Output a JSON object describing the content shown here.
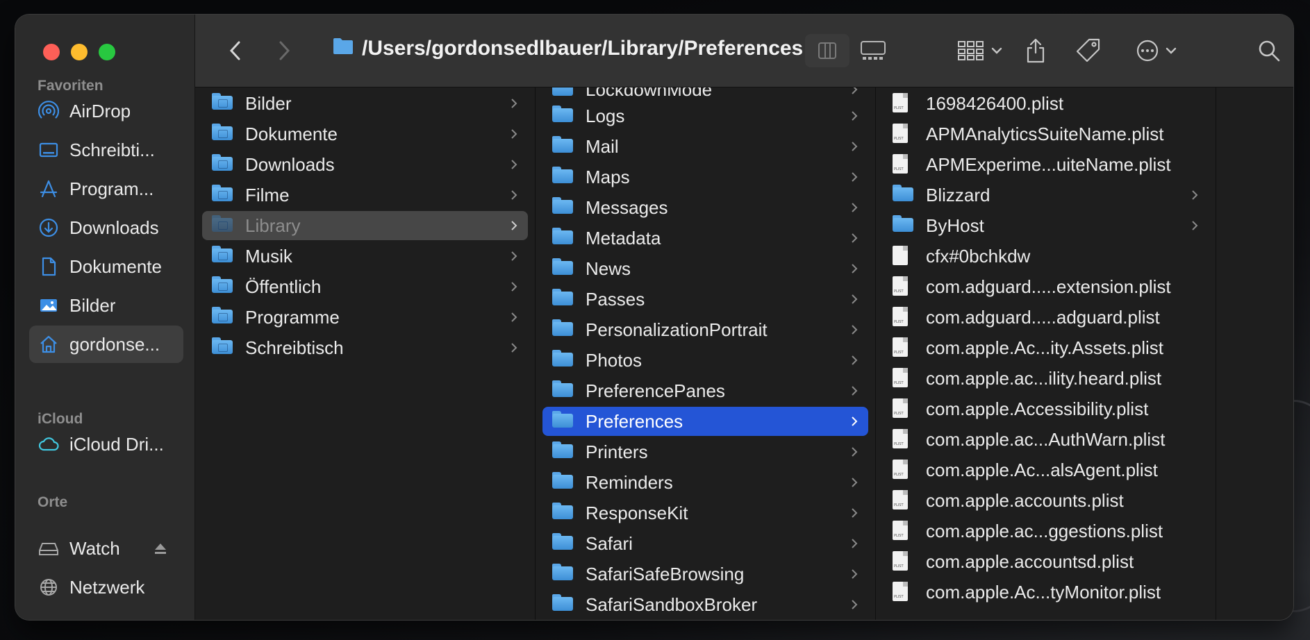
{
  "window": {
    "path": "/Users/gordonsedlbauer/Library/Preferences"
  },
  "sidebar": {
    "sections": [
      {
        "title": "Favoriten",
        "items": [
          {
            "label": "AirDrop",
            "icon": "airdrop-icon"
          },
          {
            "label": "Schreibti...",
            "icon": "desktop-icon"
          },
          {
            "label": "Program...",
            "icon": "applications-icon"
          },
          {
            "label": "Downloads",
            "icon": "downloads-icon"
          },
          {
            "label": "Dokumente",
            "icon": "document-icon"
          },
          {
            "label": "Bilder",
            "icon": "photo-icon"
          },
          {
            "label": "gordonse...",
            "icon": "home-icon",
            "active": true
          }
        ]
      },
      {
        "title": "iCloud",
        "items": [
          {
            "label": "iCloud Dri...",
            "icon": "icloud-icon"
          }
        ]
      },
      {
        "title": "Orte",
        "items": [
          {
            "label": "Watch",
            "icon": "drive-icon"
          },
          {
            "label": "Netzwerk",
            "icon": "network-icon"
          }
        ]
      }
    ]
  },
  "columns": [
    {
      "items": [
        {
          "label": "Bilder",
          "kind": "folder"
        },
        {
          "label": "Dokumente",
          "kind": "folder"
        },
        {
          "label": "Downloads",
          "kind": "folder"
        },
        {
          "label": "Filme",
          "kind": "folder"
        },
        {
          "label": "Library",
          "kind": "folder",
          "state": "selected-inactive"
        },
        {
          "label": "Musik",
          "kind": "folder"
        },
        {
          "label": "Öffentlich",
          "kind": "folder"
        },
        {
          "label": "Programme",
          "kind": "folder"
        },
        {
          "label": "Schreibtisch",
          "kind": "folder"
        }
      ]
    },
    {
      "items": [
        {
          "label": "LockdownMode",
          "kind": "folder"
        },
        {
          "label": "Logs",
          "kind": "folder"
        },
        {
          "label": "Mail",
          "kind": "folder"
        },
        {
          "label": "Maps",
          "kind": "folder"
        },
        {
          "label": "Messages",
          "kind": "folder"
        },
        {
          "label": "Metadata",
          "kind": "folder"
        },
        {
          "label": "News",
          "kind": "folder"
        },
        {
          "label": "Passes",
          "kind": "folder"
        },
        {
          "label": "PersonalizationPortrait",
          "kind": "folder"
        },
        {
          "label": "Photos",
          "kind": "folder"
        },
        {
          "label": "PreferencePanes",
          "kind": "folder"
        },
        {
          "label": "Preferences",
          "kind": "folder",
          "state": "selected-active"
        },
        {
          "label": "Printers",
          "kind": "folder"
        },
        {
          "label": "Reminders",
          "kind": "folder"
        },
        {
          "label": "ResponseKit",
          "kind": "folder"
        },
        {
          "label": "Safari",
          "kind": "folder"
        },
        {
          "label": "SafariSafeBrowsing",
          "kind": "folder"
        },
        {
          "label": "SafariSandboxBroker",
          "kind": "folder"
        }
      ]
    },
    {
      "items": [
        {
          "label": "1698426400.plist",
          "kind": "file"
        },
        {
          "label": "APMAnalyticsSuiteName.plist",
          "kind": "file"
        },
        {
          "label": "APMExperime...uiteName.plist",
          "kind": "file"
        },
        {
          "label": "Blizzard",
          "kind": "folder"
        },
        {
          "label": "ByHost",
          "kind": "folder"
        },
        {
          "label": "cfx#0bchkdw",
          "kind": "file"
        },
        {
          "label": "com.adguard.....extension.plist",
          "kind": "file"
        },
        {
          "label": "com.adguard.....adguard.plist",
          "kind": "file"
        },
        {
          "label": "com.apple.Ac...ity.Assets.plist",
          "kind": "file"
        },
        {
          "label": "com.apple.ac...ility.heard.plist",
          "kind": "file"
        },
        {
          "label": "com.apple.Accessibility.plist",
          "kind": "file"
        },
        {
          "label": "com.apple.ac...AuthWarn.plist",
          "kind": "file"
        },
        {
          "label": "com.apple.Ac...alsAgent.plist",
          "kind": "file"
        },
        {
          "label": "com.apple.accounts.plist",
          "kind": "file"
        },
        {
          "label": "com.apple.ac...ggestions.plist",
          "kind": "file"
        },
        {
          "label": "com.apple.accountsd.plist",
          "kind": "file"
        },
        {
          "label": "com.apple.Ac...tyMonitor.plist",
          "kind": "file"
        }
      ]
    }
  ],
  "colors": {
    "selection": "#2455d6",
    "folder": "#5aa7e8"
  }
}
